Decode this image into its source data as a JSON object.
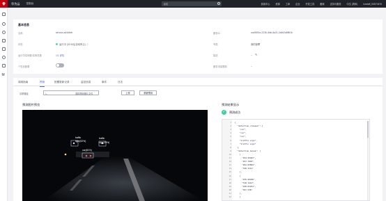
{
  "topbar": {
    "brand": "华为云",
    "console": "控制台",
    "search_placeholder": "搜索",
    "menu": [
      "费用中心",
      "资源",
      "工单",
      "企业",
      "开发工具",
      "备案",
      "支持与服务",
      "中文 (简体)",
      "hwstaff_l00574676"
    ]
  },
  "basic_info": {
    "title": "基本信息",
    "left": [
      {
        "label": "名称",
        "value": "service-ad4dfcfe"
      },
      {
        "label": "状态",
        "value": "运行中 (30:32后自动停止)"
      },
      {
        "label": "运行中实例数/实例总数",
        "value": "1/1 详情"
      },
      {
        "label": "个性化配置",
        "value": ""
      }
    ],
    "right": [
      {
        "label": "服务ID",
        "value": "cca9891e-2236-4fde-8a21-2db52a5f8f1b"
      },
      {
        "label": "专属",
        "value": "我的部署"
      },
      {
        "label": "描述",
        "value": "--"
      },
      {
        "label": "服务流量限制",
        "value": "--"
      }
    ]
  },
  "tabs": [
    "调用指南",
    "预测",
    "配置更新记录",
    "监控信息",
    "事件",
    "日志"
  ],
  "active_tab": "预测",
  "form": {
    "method_label": "请求路径",
    "method_value": "/",
    "file_label": "选择预测图片文件",
    "upload_btn": "上传",
    "predict_btn": "重新预测"
  },
  "left_panel": {
    "title": "预测图片预览",
    "detections": [
      {
        "label": "traffic"
      },
      {
        "label": "light(52%)"
      },
      {
        "label": "car(81%)"
      },
      {
        "label": "traffic"
      },
      {
        "label": "sign(49%)"
      }
    ]
  },
  "right_panel": {
    "title": "预测结果显示",
    "status": "预测成功",
    "code_lines": [
      "{",
      "  \"detection_classes\": [",
      "    \"car\",",
      "    \"car\",",
      "    \"car\",",
      "    \"traffic sign\",",
      "    \"traffic sign\"",
      "  ],",
      "  \"detection_boxes\": [",
      "    [",
      "      \"224.56403\",",
      "      \"257.7093\",",
      "      \"262.02804\",",
      "      \"320.2111\"",
      "    ],",
      "    [",
      "      \"235.99456\",",
      "      \"318.1412\",",
      "      \"248.81451\",",
      "      \"367.538\"",
      "    ],",
      "    ["
    ]
  }
}
